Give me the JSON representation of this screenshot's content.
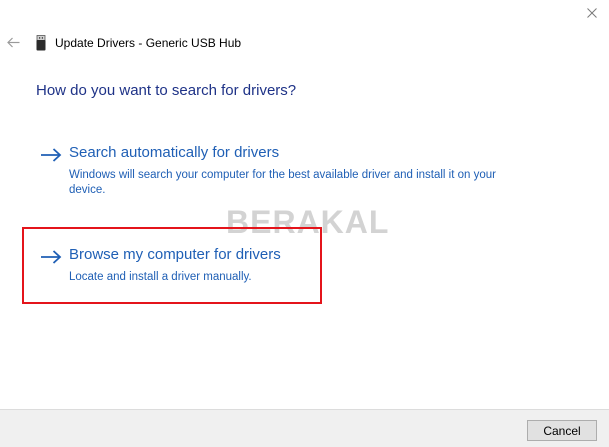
{
  "window": {
    "title": "Update Drivers - Generic USB Hub"
  },
  "icons": {
    "close": "close-icon",
    "back": "back-arrow-icon",
    "device": "usb-device-icon",
    "option_arrow": "arrow-right-icon"
  },
  "main": {
    "heading": "How do you want to search for drivers?",
    "options": [
      {
        "title": "Search automatically for drivers",
        "description": "Windows will search your computer for the best available driver and install it on your device."
      },
      {
        "title": "Browse my computer for drivers",
        "description": "Locate and install a driver manually."
      }
    ]
  },
  "watermark": "BERAKAL",
  "footer": {
    "cancel_label": "Cancel"
  },
  "colors": {
    "heading": "#1e3287",
    "link": "#1f5fb5",
    "highlight": "#e4141b",
    "footer_bg": "#f0f0f0"
  }
}
